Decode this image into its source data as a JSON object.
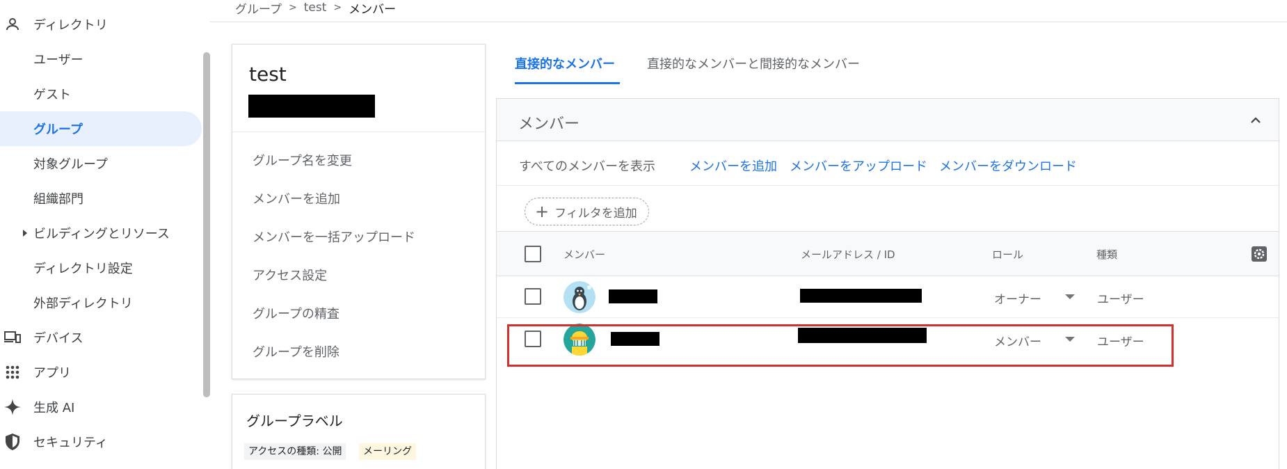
{
  "breadcrumb": {
    "items": [
      "グループ",
      "test",
      "メンバー"
    ],
    "separator": ">"
  },
  "sidebar": {
    "items": [
      {
        "label": "ディレクトリ",
        "icon": "person-icon"
      },
      {
        "label": "ユーザー"
      },
      {
        "label": "ゲスト"
      },
      {
        "label": "グループ",
        "active": true
      },
      {
        "label": "対象グループ"
      },
      {
        "label": "組織部門"
      },
      {
        "label": "ビルディングとリソース",
        "expandable": true
      },
      {
        "label": "ディレクトリ設定"
      },
      {
        "label": "外部ディレクトリ"
      },
      {
        "label": "デバイス",
        "icon": "devices-icon"
      },
      {
        "label": "アプリ",
        "icon": "apps-grid-icon"
      },
      {
        "label": "生成 AI",
        "icon": "sparkle-icon"
      },
      {
        "label": "セキュリティ",
        "icon": "shield-icon"
      }
    ]
  },
  "group_card": {
    "title": "test",
    "actions": [
      "グループ名を変更",
      "メンバーを追加",
      "メンバーを一括アップロード",
      "アクセス設定",
      "グループの精査",
      "グループを削除"
    ]
  },
  "labels_card": {
    "title": "グループラベル",
    "chips": [
      "アクセスの種類: 公開",
      "メーリング"
    ]
  },
  "tabs": [
    {
      "label": "直接的なメンバー",
      "active": true
    },
    {
      "label": "直接的なメンバーと間接的なメンバー",
      "active": false
    }
  ],
  "members_panel": {
    "title": "メンバー",
    "actions": {
      "show_all": "すべてのメンバーを表示",
      "add": "メンバーを追加",
      "upload": "メンバーをアップロード",
      "download": "メンバーをダウンロード"
    },
    "filter_label": "フィルタを追加",
    "columns": [
      "メンバー",
      "メールアドレス / ID",
      "ロール",
      "種類"
    ],
    "rows": [
      {
        "role": "オーナー",
        "type": "ユーザー",
        "avatar": "penguin-avatar-icon"
      },
      {
        "role": "メンバー",
        "type": "ユーザー",
        "avatar": "hardhat-avatar-icon",
        "highlighted": true
      }
    ]
  },
  "colors": {
    "accent": "#1a73e8",
    "active_bg": "#e8f0fe",
    "highlight_border": "#d32f2f"
  }
}
